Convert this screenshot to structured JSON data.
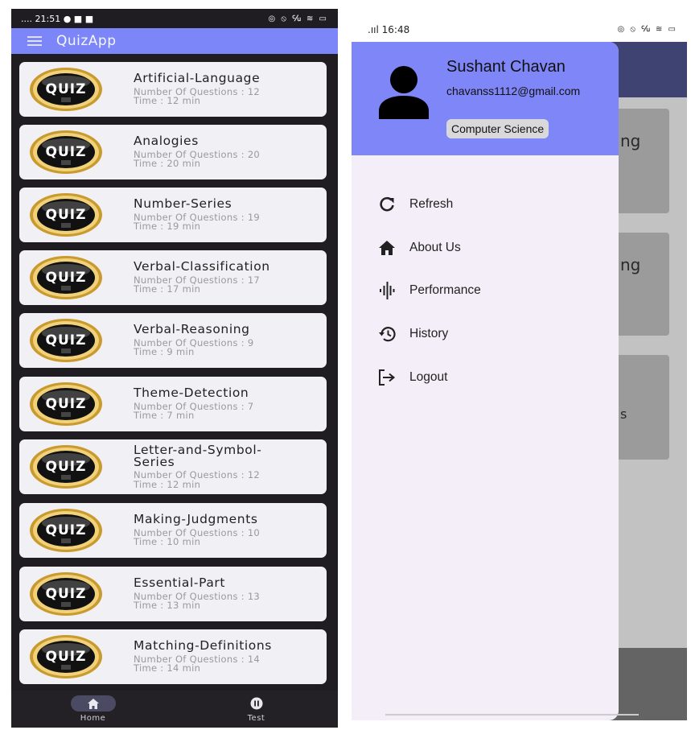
{
  "left": {
    "status": {
      "time": "21:51",
      "signal": "....",
      "left_icons": "● ■ ■",
      "right_icons": "◎ ⦸ ℆ ≋ ▭"
    },
    "app_title": "QuizApp",
    "quizzes": [
      {
        "title": "Artificial-Language",
        "questions": "Number Of Questions : 12",
        "time": "Time : 12 min"
      },
      {
        "title": "Analogies",
        "questions": "Number Of Questions : 20",
        "time": "Time : 20 min"
      },
      {
        "title": "Number-Series",
        "questions": "Number Of Questions : 19",
        "time": "Time : 19 min"
      },
      {
        "title": "Verbal-Classification",
        "questions": "Number Of Questions : 17",
        "time": "Time : 17 min"
      },
      {
        "title": "Verbal-Reasoning",
        "questions": "Number Of Questions : 9",
        "time": "Time : 9 min"
      },
      {
        "title": "Theme-Detection",
        "questions": "Number Of Questions : 7",
        "time": "Time : 7 min"
      },
      {
        "title": "Letter-and-Symbol-Series",
        "questions": "Number Of Questions : 12",
        "time": "Time : 12 min"
      },
      {
        "title": "Making-Judgments",
        "questions": "Number Of Questions : 10",
        "time": "Time : 10 min"
      },
      {
        "title": "Essential-Part",
        "questions": "Number Of Questions : 13",
        "time": "Time : 13 min"
      },
      {
        "title": "Matching-Definitions",
        "questions": "Number Of Questions : 14",
        "time": "Time : 14 min"
      }
    ],
    "badge_text": "QUIZ",
    "nav": {
      "home": "Home",
      "test": "Test"
    }
  },
  "right": {
    "status": {
      "time": "16:48",
      "right_icons": "◎ ⦸ ℆ ≋ ▭"
    },
    "profile": {
      "name": "Sushant Chavan",
      "email": "chavanss1112@gmail.com",
      "department": "Computer Science"
    },
    "menu": [
      {
        "label": "Refresh",
        "icon": "refresh-icon"
      },
      {
        "label": "About Us",
        "icon": "home-icon"
      },
      {
        "label": "Performance",
        "icon": "waveform-icon"
      },
      {
        "label": "History",
        "icon": "history-icon"
      },
      {
        "label": "Logout",
        "icon": "logout-icon"
      }
    ],
    "bg_fragments": [
      "ng",
      "ng",
      "s"
    ]
  },
  "colors": {
    "primary": "#7d86f8",
    "drawer_bg": "#f3eef7",
    "dark_bg": "#1f1d22"
  }
}
